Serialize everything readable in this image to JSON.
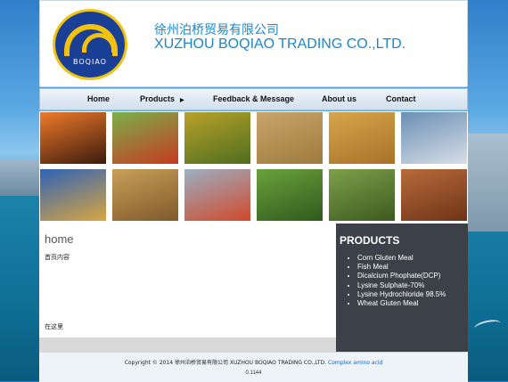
{
  "header": {
    "logo_text": "BOQIAO",
    "company_cn": "徐州泊桥贸易有限公司",
    "company_en": "XUZHOU BOQIAO TRADING CO.,LTD."
  },
  "nav": {
    "items": [
      {
        "label": "Home"
      },
      {
        "label": "Products"
      },
      {
        "label": "Feedback & Message"
      },
      {
        "label": "About us"
      },
      {
        "label": "Contact"
      }
    ]
  },
  "gallery": {
    "tiles": [
      {
        "subject": "oil-pump-sunset",
        "colors": [
          "#f07a2a",
          "#3a1b0d"
        ]
      },
      {
        "subject": "tractor-field",
        "colors": [
          "#7bb04a",
          "#c63a22"
        ]
      },
      {
        "subject": "sugarcane",
        "colors": [
          "#b9a12a",
          "#4e6e1f"
        ]
      },
      {
        "subject": "grain-pile",
        "colors": [
          "#caa56b",
          "#9f7a3f"
        ]
      },
      {
        "subject": "soybeans",
        "colors": [
          "#d8a54a",
          "#a8722a"
        ]
      },
      {
        "subject": "chemical-plant",
        "colors": [
          "#6b8fb5",
          "#d7dee6"
        ]
      },
      {
        "subject": "wheat-field",
        "colors": [
          "#2e62b8",
          "#d8a640"
        ]
      },
      {
        "subject": "gluten-chunks",
        "colors": [
          "#c99f58",
          "#7f5a2a"
        ]
      },
      {
        "subject": "container-port",
        "colors": [
          "#9bb0c2",
          "#d1492a"
        ]
      },
      {
        "subject": "broccoli-field",
        "colors": [
          "#6aa23c",
          "#2f5a1d"
        ]
      },
      {
        "subject": "reed-grass",
        "colors": [
          "#7da04a",
          "#3d5a1f"
        ]
      },
      {
        "subject": "corn-flakes",
        "colors": [
          "#b86a3b",
          "#6e3417"
        ]
      }
    ]
  },
  "content": {
    "title": "home",
    "placeholder_top": "首页内容",
    "placeholder_bottom": "在这里"
  },
  "products": {
    "title": "PRODUCTS",
    "items": [
      "Corn Gluten Meal",
      "Fish Meal",
      "Dicalcium Phophate(DCP)",
      "Lysine Sulphate-70%",
      "Lysine Hydrochloride 98.5%",
      "Wheat Gluten Meal"
    ]
  },
  "footer": {
    "copyright": "Copyright © 2014 徐州泊桥贸易有限公司 XUZHOU BOQIAO TRADING CO.,LTD.",
    "link": "Complex amino acid",
    "stats": "0.1144"
  }
}
